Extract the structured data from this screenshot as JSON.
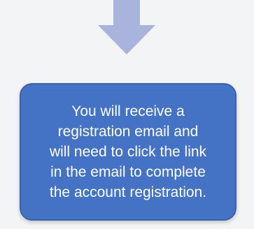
{
  "flow": {
    "arrow_icon": "down-arrow-icon",
    "arrow_color": "#a9b4dd",
    "step": {
      "text": "You will receive a\nregistration email and\nwill need to click the link\nin the email to complete\nthe account registration.",
      "background": "#4472c4",
      "text_color": "#ffffff"
    }
  }
}
